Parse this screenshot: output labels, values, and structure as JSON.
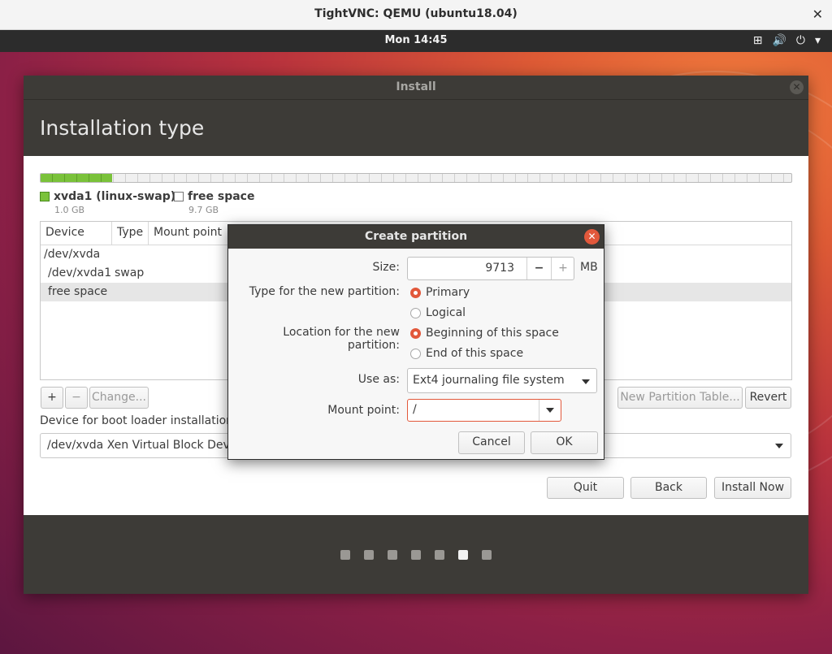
{
  "vnc": {
    "title": "TightVNC: QEMU (ubuntu18.04)",
    "close_glyph": "✕"
  },
  "top_panel": {
    "clock": "Mon 14:45",
    "icons": [
      "network-icon",
      "volume-icon",
      "power-icon",
      "chevron-down-icon"
    ],
    "glyphs": {
      "network": "⊞",
      "volume": "🔊",
      "power": "⏻",
      "menu": "▾"
    }
  },
  "window": {
    "title": "Install",
    "close_glyph": "✕",
    "heading": "Installation type"
  },
  "partition_bar": {
    "used_fraction": 0.095
  },
  "legend": [
    {
      "name": "xvda1 (linux-swap)",
      "size": "1.0 GB",
      "color": "#7ac23a"
    },
    {
      "name": "free space",
      "size": "9.7 GB",
      "color": "#ffffff"
    }
  ],
  "table": {
    "columns": [
      "Device",
      "Type",
      "Mount point"
    ],
    "rows": [
      {
        "device": "/dev/xvda",
        "type": ""
      },
      {
        "device": "/dev/xvda1",
        "type": "swap"
      },
      {
        "device": "free space",
        "type": ""
      }
    ]
  },
  "table_buttons": {
    "add": "+",
    "remove": "−",
    "change": "Change...",
    "new_table": "New Partition Table...",
    "revert": "Revert"
  },
  "bootloader": {
    "label": "Device for boot loader installation:",
    "value": "/dev/xvda Xen Virtual Block Device (10.7 GB)"
  },
  "nav_buttons": {
    "quit": "Quit",
    "back": "Back",
    "install_now": "Install Now"
  },
  "progress_dots": {
    "count": 7,
    "active_index": 5
  },
  "dialog": {
    "title": "Create partition",
    "close_glyph": "✕",
    "size_label": "Size:",
    "size_value": "9713",
    "size_minus": "−",
    "size_plus": "+",
    "size_unit": "MB",
    "type_label": "Type for the new partition:",
    "type_options": [
      "Primary",
      "Logical"
    ],
    "type_selected": "Primary",
    "location_label": "Location for the new partition:",
    "location_options": [
      "Beginning of this space",
      "End of this space"
    ],
    "location_selected": "Beginning of this space",
    "use_as_label": "Use as:",
    "use_as_value": "Ext4 journaling file system",
    "mount_label": "Mount point:",
    "mount_value": "/",
    "cancel": "Cancel",
    "ok": "OK",
    "accent": "#e2583b"
  }
}
